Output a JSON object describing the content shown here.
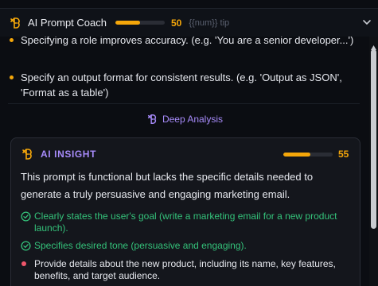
{
  "header": {
    "title": "AI Prompt Coach",
    "score": "50",
    "score_fraction": 0.5,
    "tip_label": "{{num}} tip",
    "accent_color": "#f5a70a"
  },
  "tips": [
    "Specifying a role improves accuracy. (e.g. 'You are a senior developer...')",
    "Specify an output format for consistent results. (e.g. 'Output as JSON', 'Format as a table')"
  ],
  "deep_analysis": {
    "label": "Deep Analysis",
    "color": "#a78bfa"
  },
  "insight": {
    "title": "AI INSIGHT",
    "score": "55",
    "score_fraction": 0.55,
    "summary": "This prompt is functional but lacks the specific details needed to generate a truly persuasive and engaging marketing email.",
    "strengths": [
      "Clearly states the user's goal (write a marketing email for a new product launch).",
      "Specifies desired tone (persuasive and engaging)."
    ],
    "improvements": [
      "Provide details about the new product, including its name, key features, benefits, and target audience."
    ],
    "positive_color": "#34c27a",
    "negative_color": "#f0566b"
  }
}
